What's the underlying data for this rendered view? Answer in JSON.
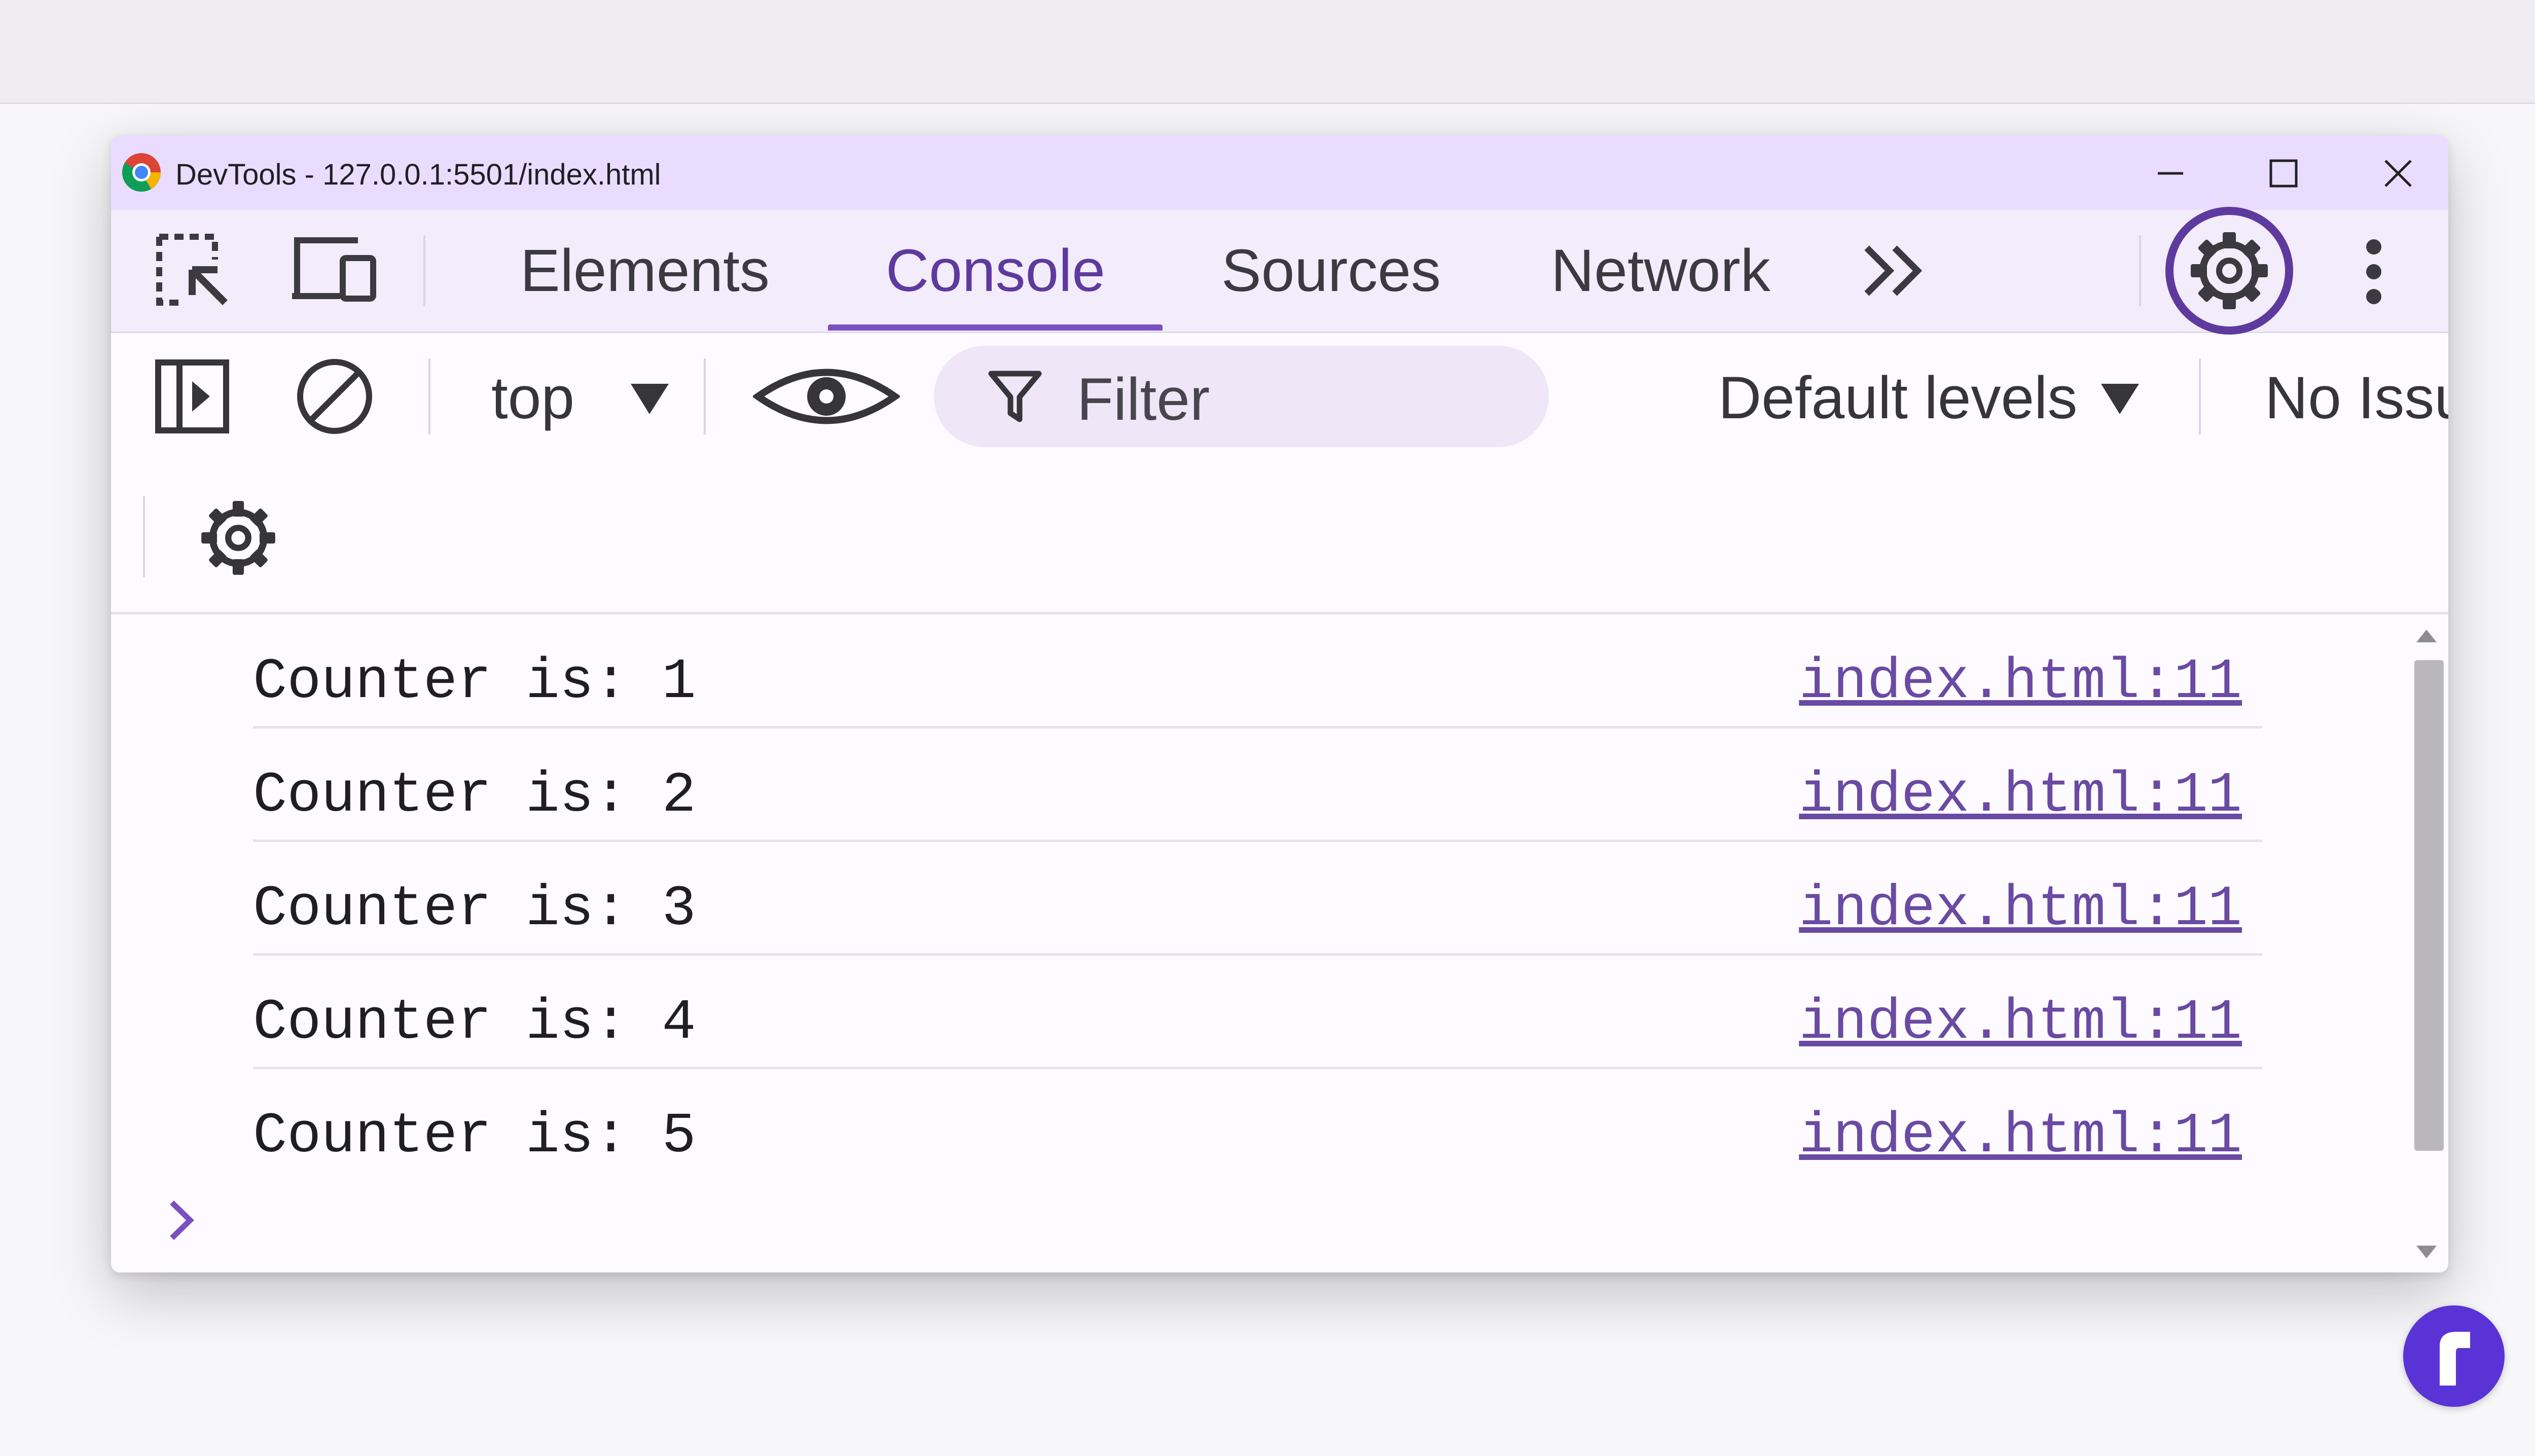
{
  "window": {
    "title": "DevTools - 127.0.0.1:5501/index.html"
  },
  "tabs": {
    "items": [
      {
        "label": "Elements",
        "active": false
      },
      {
        "label": "Console",
        "active": true
      },
      {
        "label": "Sources",
        "active": false
      },
      {
        "label": "Network",
        "active": false
      }
    ]
  },
  "toolbar": {
    "context_label": "top",
    "filter_placeholder": "Filter",
    "levels_label": "Default levels",
    "issues_label": "No Issues"
  },
  "console": {
    "logs": [
      {
        "message": "Counter is: 1",
        "source": "index.html:11"
      },
      {
        "message": "Counter is: 2",
        "source": "index.html:11"
      },
      {
        "message": "Counter is: 3",
        "source": "index.html:11"
      },
      {
        "message": "Counter is: 4",
        "source": "index.html:11"
      },
      {
        "message": "Counter is: 5",
        "source": "index.html:11"
      }
    ]
  },
  "colors": {
    "accent": "#7a4fc1",
    "titlebar": "#eadcff",
    "link": "#6a4aa3",
    "badge": "#5a33d6"
  }
}
